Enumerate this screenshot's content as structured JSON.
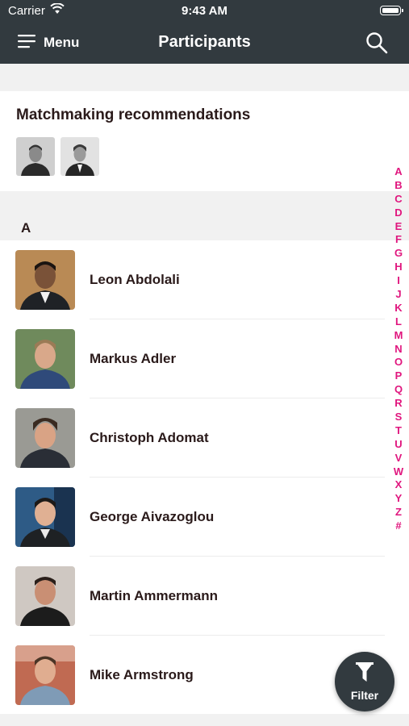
{
  "status_bar": {
    "carrier": "Carrier",
    "time": "9:43 AM"
  },
  "nav": {
    "menu_label": "Menu",
    "title": "Participants"
  },
  "matchmaking": {
    "title": "Matchmaking recommendations",
    "count": 2
  },
  "section": {
    "letter": "A"
  },
  "participants": [
    {
      "name": "Leon Abdolali"
    },
    {
      "name": "Markus Adler"
    },
    {
      "name": "Christoph Adomat"
    },
    {
      "name": "George Aivazoglou"
    },
    {
      "name": "Martin Ammermann"
    },
    {
      "name": "Mike Armstrong"
    }
  ],
  "alphabet_index": [
    "A",
    "B",
    "C",
    "D",
    "E",
    "F",
    "G",
    "H",
    "I",
    "J",
    "K",
    "L",
    "M",
    "N",
    "O",
    "P",
    "Q",
    "R",
    "S",
    "T",
    "U",
    "V",
    "W",
    "X",
    "Y",
    "Z",
    "#"
  ],
  "filter": {
    "label": "Filter"
  },
  "colors": {
    "accent": "#e0167e",
    "bar": "#323a3f",
    "band": "#f1f1f1"
  }
}
